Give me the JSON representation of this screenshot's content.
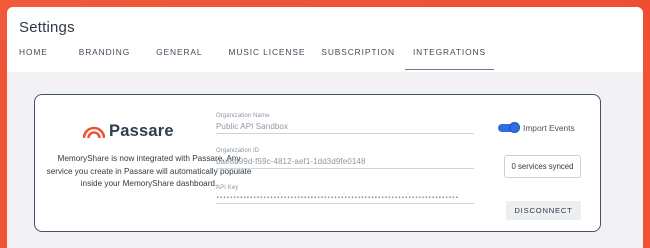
{
  "settings": {
    "title": "Settings"
  },
  "tabs": [
    {
      "label": "HOME"
    },
    {
      "label": "BRANDING"
    },
    {
      "label": "GENERAL"
    },
    {
      "label": "MUSIC LICENSE"
    },
    {
      "label": "SUBSCRIPTION"
    },
    {
      "label": "INTEGRATIONS",
      "active": true
    }
  ],
  "integration": {
    "logo_text": "Passare",
    "description": "MemoryShare is now integrated with Passare. Any service you create in Passare will automatically populate inside your MemoryShare dashboard.",
    "org_name_label": "Organization Name",
    "org_name_value": "Public API Sandbox",
    "org_id_label": "Organization ID",
    "org_id_value": "dae8b99d-f59c-4812-aef1-1dd3d9fe0148",
    "api_key_label": "API Key",
    "api_key_value": "••••••••••••••••••••••••••••••••••••••••••••••••••••••••••••••••••••••••",
    "import_events_label": "Import Events",
    "import_events_enabled": true,
    "services_synced": "0 services synced",
    "disconnect_label": "DISCONNECT"
  },
  "colors": {
    "brand_accent": "#ef5436",
    "panel_border": "#3d5568",
    "toggle_on": "#2f6fe3"
  },
  "icons": {
    "logo_mark": "passare-logo-icon"
  }
}
